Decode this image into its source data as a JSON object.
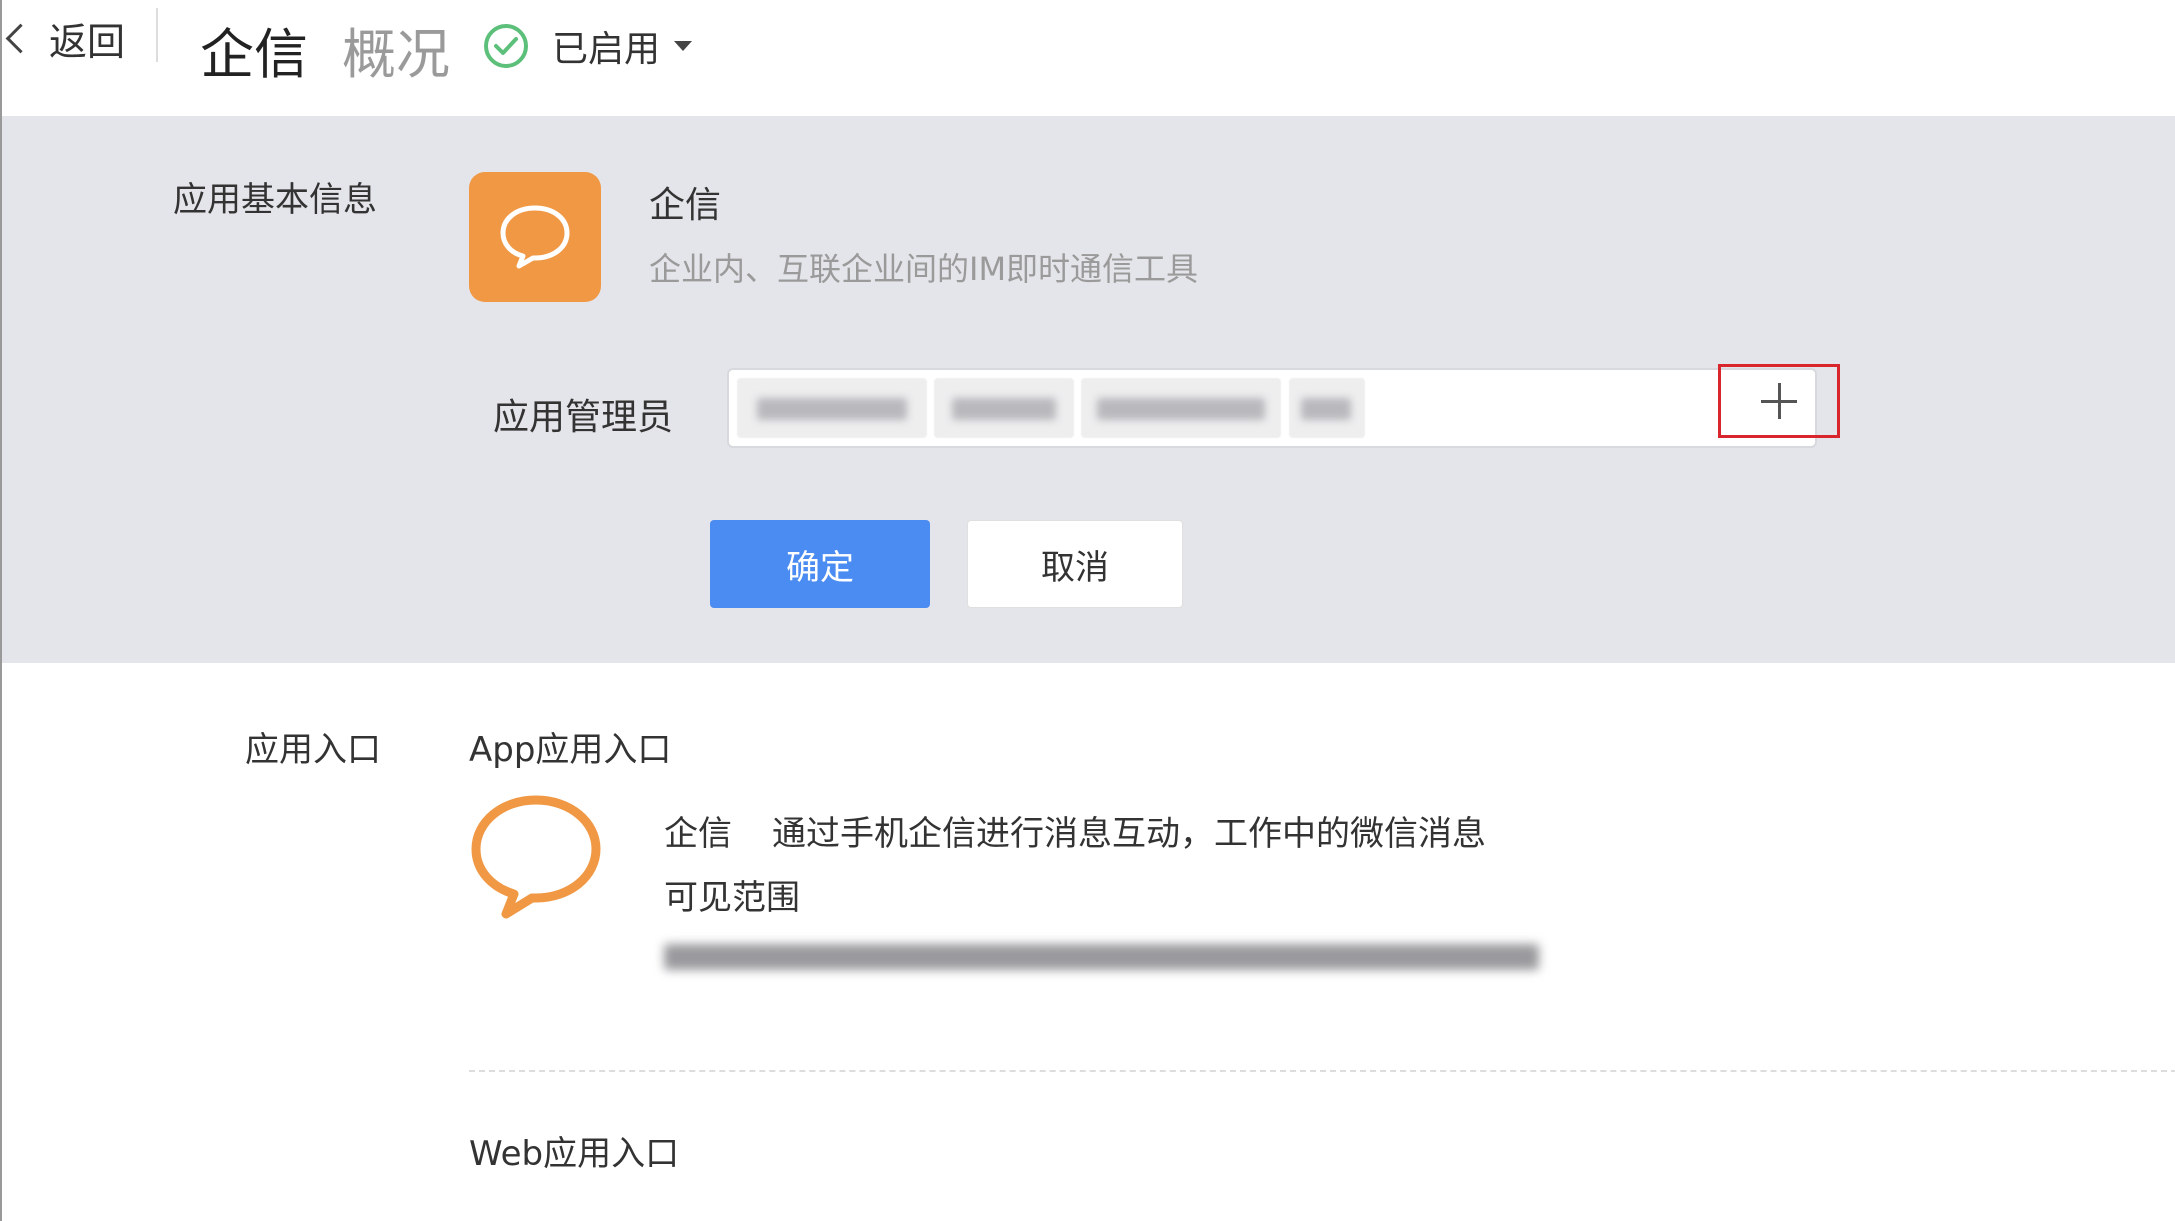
{
  "header": {
    "back_label": "返回",
    "app_title": "企信",
    "tab_overview": "概况",
    "status_label": "已启用"
  },
  "basic_info": {
    "section_label": "应用基本信息",
    "app_name": "企信",
    "app_description": "企业内、互联企业间的IM即时通信工具",
    "icon_color": "#f09844"
  },
  "admin": {
    "label": "应用管理员",
    "add_icon": "plus-icon"
  },
  "actions": {
    "confirm_label": "确定",
    "cancel_label": "取消",
    "confirm_color": "#4a8cf2"
  },
  "entry": {
    "section_label": "应用入口",
    "app_entry_title": "App应用入口",
    "app_entry_name": "企信",
    "app_entry_desc": "通过手机企信进行消息互动，工作中的微信消息",
    "visible_scope_label": "可见范围",
    "web_entry_title": "Web应用入口"
  },
  "colors": {
    "accent_green": "#5cbf7a",
    "highlight_red": "#d9262c",
    "panel_bg": "#e4e5ea"
  }
}
